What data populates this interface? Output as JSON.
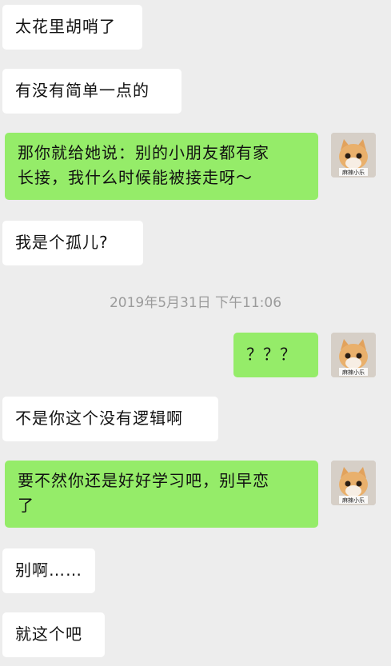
{
  "messages": [
    {
      "side": "left",
      "text": "太花里胡哨了"
    },
    {
      "side": "left",
      "text": "有没有简单一点的"
    },
    {
      "side": "right",
      "lines": [
        "那你就给她说：别的小朋友都有家",
        "长接，我什么时候能被接走呀～"
      ]
    },
    {
      "side": "left",
      "text": "我是个孤儿?"
    },
    {
      "side": "right",
      "text": "？？？"
    },
    {
      "side": "left",
      "text": "不是你这个没有逻辑啊"
    },
    {
      "side": "right",
      "lines": [
        "要不然你还是好好学习吧，别早恋",
        "了"
      ]
    },
    {
      "side": "left",
      "text": "别啊……"
    },
    {
      "side": "left",
      "text": "就这个吧"
    }
  ],
  "timestamp": "2019年5月31日 下午11:06",
  "avatar": {
    "icon": "cat-avatar-icon",
    "caption": "麻辣小乐"
  },
  "colors": {
    "background": "#ededed",
    "left_bubble": "#ffffff",
    "right_bubble": "#95ec69"
  }
}
